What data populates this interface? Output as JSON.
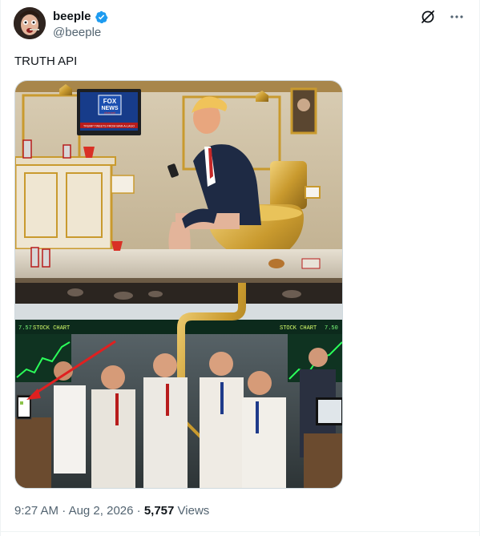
{
  "author": {
    "display_name": "beeple",
    "handle": "@beeple"
  },
  "tweet": {
    "text": "TRUTH API",
    "media": {
      "tv_logo_line1": "FOX",
      "tv_logo_line2": "NEWS",
      "tv_logo_line3": "channel",
      "tv_ticker": "TRUMP TWEETS FROM MAR-A-LAGO",
      "board_left": "STOCK CHART",
      "board_left_num": "7.57",
      "board_right": "STOCK CHART",
      "board_right_num": "7.50"
    }
  },
  "meta": {
    "time": "9:27 AM",
    "separator": "·",
    "date": "Aug 2, 2026",
    "views_count": "5,757",
    "views_label": "Views"
  },
  "colors": {
    "verified": "#1d9bf0",
    "secondary_text": "#536471",
    "gold": "#c99a2e"
  }
}
